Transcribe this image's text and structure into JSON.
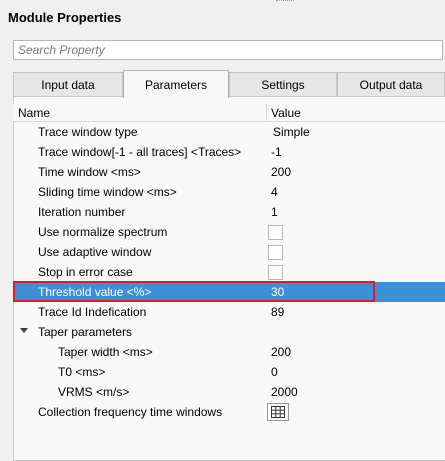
{
  "window": {
    "title": "Module Properties"
  },
  "search": {
    "placeholder": "Search Property"
  },
  "tabs": [
    {
      "label": "Input data"
    },
    {
      "label": "Parameters"
    },
    {
      "label": "Settings"
    },
    {
      "label": "Output data"
    }
  ],
  "table": {
    "header": {
      "name": "Name",
      "value": "Value"
    },
    "rows": [
      {
        "name": "Trace window type",
        "value": "Simple"
      },
      {
        "name": "Trace window[-1 - all traces] <Traces>",
        "value": "-1"
      },
      {
        "name": "Time window <ms>",
        "value": "200"
      },
      {
        "name": "Sliding time window <ms>",
        "value": "4"
      },
      {
        "name": "Iteration number",
        "value": "1"
      },
      {
        "name": "Use normalize spectrum",
        "value": "",
        "checked": false
      },
      {
        "name": "Use adaptive window",
        "value": "",
        "checked": false
      },
      {
        "name": "Stop in error case",
        "value": "",
        "checked": false
      },
      {
        "name": "Threshold value <%>",
        "value": "30",
        "selected": true
      },
      {
        "name": "Trace Id Indefication",
        "value": "89"
      },
      {
        "name": "Taper parameters",
        "value": "",
        "expanded": true
      },
      {
        "name": "Taper width <ms>",
        "value": "200"
      },
      {
        "name": "T0 <ms>",
        "value": "0"
      },
      {
        "name": "VRMS <m/s>",
        "value": "2000"
      },
      {
        "name": "Collection frequency time windows",
        "value": ""
      }
    ]
  },
  "colors": {
    "selection": "#3d8fd8",
    "highlight_border": "#e11b22"
  },
  "icons": {
    "group_toggle": "triangle-down-icon",
    "table_editor": "table-grid-icon"
  }
}
